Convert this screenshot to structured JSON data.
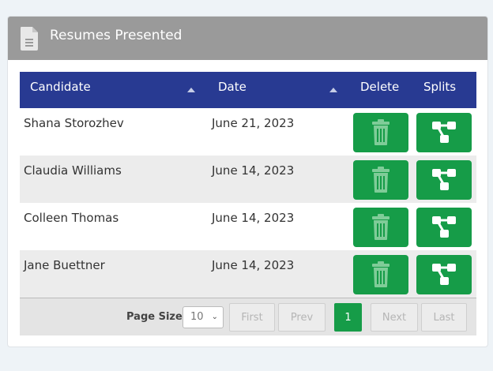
{
  "panel": {
    "title": "Resumes Presented"
  },
  "columns": {
    "candidate": "Candidate",
    "date": "Date",
    "delete": "Delete",
    "splits": "Splits"
  },
  "rows": [
    {
      "candidate": "Shana Storozhev",
      "date": "June 21, 2023"
    },
    {
      "candidate": "Claudia Williams",
      "date": "June 14, 2023"
    },
    {
      "candidate": "Colleen Thomas",
      "date": "June 14, 2023"
    },
    {
      "candidate": "Jane Buettner",
      "date": "June 14, 2023"
    }
  ],
  "pager": {
    "page_size_label": "Page Size",
    "page_size_value": "10",
    "first": "First",
    "prev": "Prev",
    "current": "1",
    "next": "Next",
    "last": "Last"
  },
  "colors": {
    "header": "#283a92",
    "accent": "#169c48",
    "panel_header": "#9a9a9a"
  },
  "icons": {
    "title": "document-icon",
    "delete": "trash-icon",
    "splits": "split-icon"
  }
}
